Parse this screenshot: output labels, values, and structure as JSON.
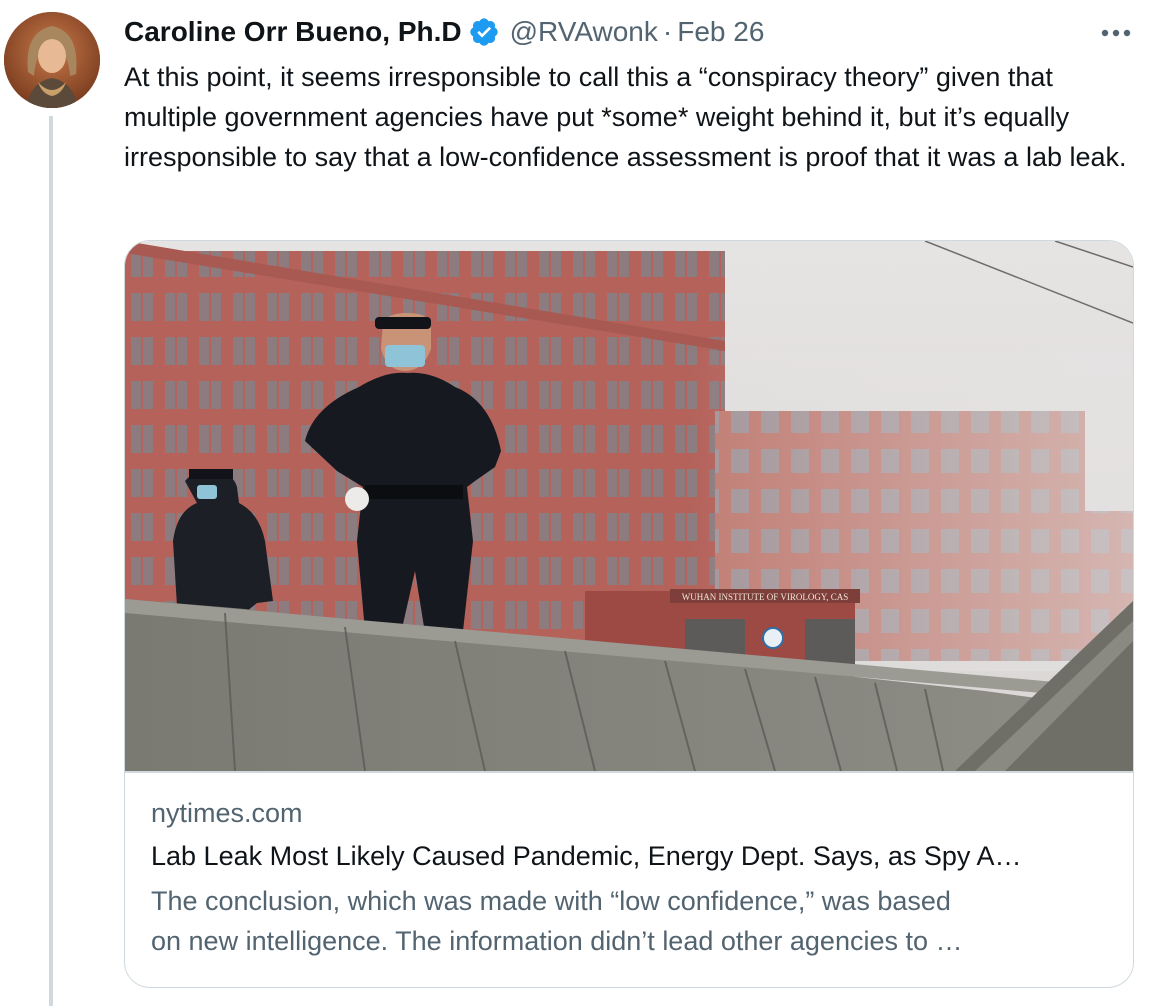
{
  "tweet": {
    "author": {
      "display_name": "Caroline Orr Bueno, Ph.D",
      "handle": "@RVAwonk",
      "verified": true,
      "avatar_icon": "profile-photo"
    },
    "separator": "·",
    "date": "Feb 26",
    "more_icon": "more-horizontal-icon",
    "text": "At this point, it seems irresponsible to call this a “conspiracy theory” given that multiple government agencies have put *some* weight behind it, but it’s equally irresponsible to say that a low-confidence assessment is proof that it was a lab leak."
  },
  "link_card": {
    "image": "photo-wuhan-institute-guards",
    "image_sign_text": "WUHAN INSTITUTE OF VIROLOGY, CAS",
    "domain": "nytimes.com",
    "title": "Lab Leak Most Likely Caused Pandemic, Energy Dept. Says, as Spy A…",
    "description_line1": "The conclusion, which was made with “low confidence,” was based",
    "description_line2": "on new intelligence. The information didn’t lead other agencies to …"
  },
  "colors": {
    "text_primary": "#0f1419",
    "text_secondary": "#536471",
    "verified_blue": "#1d9bf0",
    "border": "#cfd9de"
  }
}
